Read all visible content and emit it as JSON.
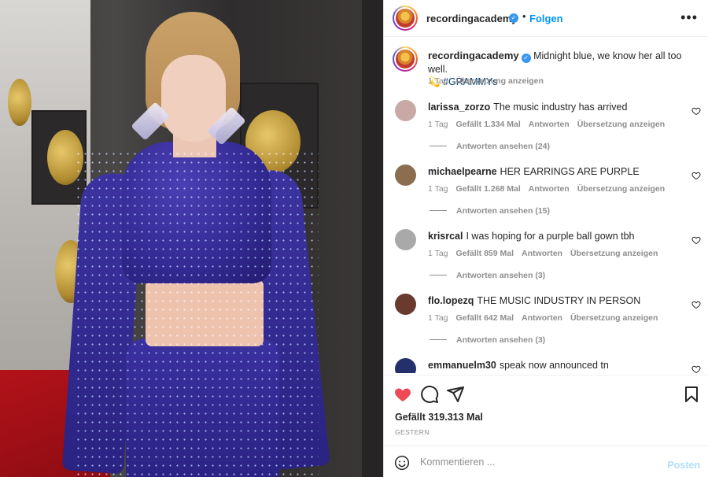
{
  "post": {
    "username": "recordingacademy",
    "follow_label": "Folgen",
    "more_icon": "more-horizontal-icon",
    "verified_icon": "verified-badge-icon"
  },
  "caption": {
    "username": "recordingacademy",
    "text": "Midnight blue, we know her all too well.",
    "emoji": "💫",
    "hashtag": "#GRAMMYs",
    "time": "1 Tag",
    "translate_label": "Übersetzung anzeigen"
  },
  "comments": [
    {
      "username": "larissa_zorzo",
      "text": "The music industry has arrived",
      "time": "1 Tag",
      "likes": "Gefällt 1.334 Mal",
      "reply_label": "Antworten",
      "translate_label": "Übersetzung anzeigen",
      "replies_label": "Antworten ansehen (24)",
      "avatar_color": "#c9a9a5"
    },
    {
      "username": "michaelpearne",
      "text": "HER EARRINGS ARE PURPLE",
      "time": "1 Tag",
      "likes": "Gefällt 1.268 Mal",
      "reply_label": "Antworten",
      "translate_label": "Übersetzung anzeigen",
      "replies_label": "Antworten ansehen (15)",
      "avatar_color": "#8a6e4f"
    },
    {
      "username": "krisrcal",
      "text": "I was hoping for a purple ball gown tbh",
      "time": "1 Tag",
      "likes": "Gefällt 859 Mal",
      "reply_label": "Antworten",
      "translate_label": "Übersetzung anzeigen",
      "replies_label": "Antworten ansehen (3)",
      "avatar_color": "#a9a9a9"
    },
    {
      "username": "flo.lopezq",
      "text": "THE MUSIC INDUSTRY IN PERSON",
      "time": "1 Tag",
      "likes": "Gefällt 642 Mal",
      "reply_label": "Antworten",
      "translate_label": "Übersetzung anzeigen",
      "replies_label": "Antworten ansehen (3)",
      "avatar_color": "#6b3a2e"
    },
    {
      "username": "emmanuelm30",
      "text": "speak now announced tn",
      "time": "",
      "likes": "",
      "reply_label": "",
      "translate_label": "",
      "replies_label": "",
      "avatar_color": "#23306b"
    }
  ],
  "actions": {
    "like_icon": "heart-filled-icon",
    "comment_icon": "comment-icon",
    "share_icon": "share-icon",
    "save_icon": "bookmark-icon",
    "likes_text": "Gefällt 319.313 Mal",
    "date": "GESTERN",
    "like_color": "#ed4956"
  },
  "composer": {
    "placeholder": "Kommentieren ...",
    "post_label": "Posten",
    "emoji_icon": "emoji-icon"
  },
  "colors": {
    "accent": "#0095f6",
    "hashtag": "#00376b",
    "muted": "#8e8e8e"
  }
}
